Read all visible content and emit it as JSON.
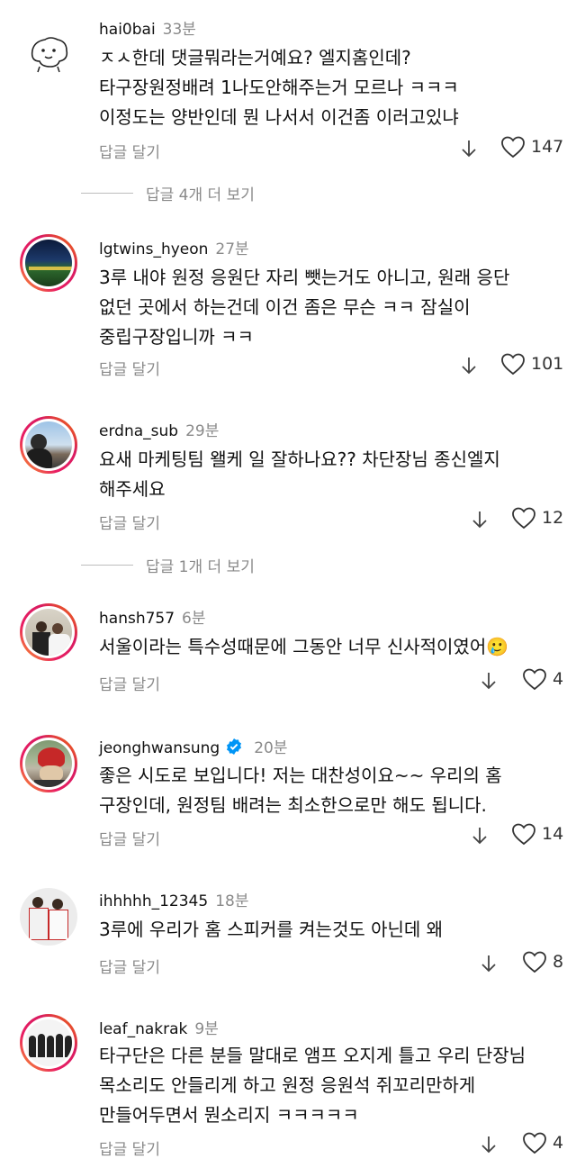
{
  "comments": [
    {
      "username": "hai0bai",
      "time": "33분",
      "lines": [
        "ㅈㅅ한데 댓글뭐라는거예요? 엘지홈인데?",
        "타구장원정배려 1나도안해주는거 모르나 ㅋㅋㅋ",
        "이정도는 양반인데 뭔 나서서 이건좀 이러고있냐"
      ],
      "reply": "답글 달기",
      "likes": "147"
    },
    {
      "username": "lgtwins_hyeon",
      "time": "27분",
      "lines": [
        "3루 내야 원정 응원단 자리 뺏는거도 아니고, 원래 응단",
        "없던 곳에서 하는건데 이건 좀은 무슨 ㅋㅋ 잠실이",
        "중립구장입니까 ㅋㅋ"
      ],
      "reply": "답글 달기",
      "likes": "101"
    },
    {
      "username": "erdna_sub",
      "time": "29분",
      "lines": [
        "요새 마케팅팀 왤케 일 잘하나요?? 차단장님 종신엘지",
        "해주세요"
      ],
      "reply": "답글 달기",
      "likes": "12"
    },
    {
      "username": "hansh757",
      "time": "6분",
      "lines": [
        "서울이라는 특수성때문에 그동안 너무 신사적이였어🥲"
      ],
      "reply": "답글 달기",
      "likes": "4"
    },
    {
      "username": "jeonghwansung",
      "time": "20분",
      "lines": [
        "좋은 시도로 보입니다! 저는 대찬성이요~~ 우리의 홈",
        "구장인데, 원정팀 배려는 최소한으로만 해도 됩니다."
      ],
      "reply": "답글 달기",
      "likes": "14"
    },
    {
      "username": "ihhhhh_12345",
      "time": "18분",
      "lines": [
        "3루에 우리가 홈 스피커를 켜는것도 아닌데 왜"
      ],
      "reply": "답글 달기",
      "likes": "8"
    },
    {
      "username": "leaf_nakrak",
      "time": "9분",
      "lines": [
        "타구단은 다른 분들 말대로 앰프 오지게 틀고 우리 단장님",
        "목소리도 안들리게 하고 원정 응원석 쥐꼬리만하게",
        "만들어두면서 뭔소리지 ㅋㅋㅋㅋㅋ"
      ],
      "reply": "답글 달기",
      "likes": "4"
    }
  ],
  "more_replies": [
    "답글 4개 더 보기",
    "답글 1개 더 보기"
  ],
  "colors": {
    "meta": "#8a8a8a",
    "verified": "#0095f6"
  }
}
